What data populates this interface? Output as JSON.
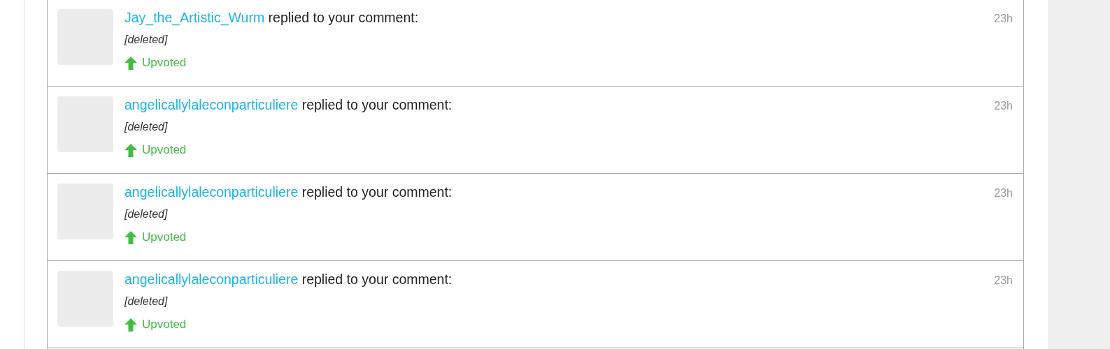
{
  "notifications": [
    {
      "user": "Jay_the_Artistic_Wurm",
      "action": "replied to your comment:",
      "time": "23h",
      "body": "[deleted]",
      "vote": {
        "kind": "upvote",
        "label": "Upvoted"
      }
    },
    {
      "user": "angelicallylaleconparticuliere",
      "action": "replied to your comment:",
      "time": "23h",
      "body": "[deleted]",
      "vote": {
        "kind": "upvote",
        "label": "Upvoted"
      }
    },
    {
      "user": "angelicallylaleconparticuliere",
      "action": "replied to your comment:",
      "time": "23h",
      "body": "[deleted]",
      "vote": {
        "kind": "upvote",
        "label": "Upvoted"
      }
    },
    {
      "user": "angelicallylaleconparticuliere",
      "action": "replied to your comment:",
      "time": "23h",
      "body": "[deleted]",
      "vote": {
        "kind": "upvote",
        "label": "Upvoted"
      }
    }
  ]
}
